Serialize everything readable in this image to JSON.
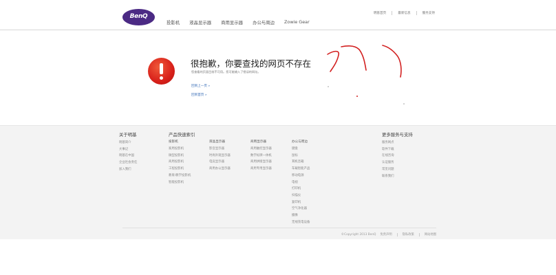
{
  "header": {
    "logo_text": "BenQ",
    "main_nav": [
      "投影机",
      "液晶显示器",
      "商用显示器",
      "办公与周边",
      "Zowie Gear"
    ],
    "top_nav": [
      "明基首页",
      "最新信息",
      "服务支持"
    ]
  },
  "error": {
    "title": "很抱歉，你要查找的网页不存在",
    "description": "您查看的页面目前不可用。您可能输入了错误的网址。",
    "link_back": "回到上一页 »",
    "link_home": "回到首页 »"
  },
  "footer": {
    "about": {
      "title": "关于明基",
      "items": [
        "明基简介",
        "大事记",
        "明基在中国",
        "企业社会责任",
        "加入我们"
      ]
    },
    "quick_index": {
      "title": "产品快速索引",
      "columns": [
        {
          "heading": "投影机",
          "items": [
            "家用投影机",
            "微型投影机",
            "商用投影机",
            "工程投影机",
            "教育/教学投影机",
            "智能投影机"
          ]
        },
        {
          "heading": "液晶显示器",
          "items": [
            "影音显示器",
            "时尚外观显示器",
            "电竞显示器",
            "商用办公显示器"
          ]
        },
        {
          "heading": "商用显示器",
          "items": [
            "商用触控显示器",
            "数字标牌一体机",
            "商用拼接显示器",
            "商用专用显示器"
          ]
        },
        {
          "heading": "办公与周边",
          "items": [
            "键盘",
            "鼠标",
            "耳机音箱",
            "车载智能产品",
            "移动电源",
            "电视",
            "打印机",
            "扫描仪",
            "复印机",
            "空气净化器",
            "摄像",
            "无线充电设备"
          ]
        }
      ]
    },
    "support": {
      "title": "更多服务与支持",
      "items": [
        "服务网点",
        "软件下载",
        "在线咨询",
        "认证服务",
        "常见问题",
        "联系我们"
      ]
    },
    "copyright": "©Copyright 2013 BenQ",
    "bottom_links": [
      "免责声明",
      "隐私政策",
      "网站地图"
    ]
  },
  "colors": {
    "logo": "#4b2a84",
    "error_icon": "#d8201a",
    "link": "#3a6fb8",
    "annotation": "#d21f1f",
    "footer_bg": "#f3f3f3"
  }
}
